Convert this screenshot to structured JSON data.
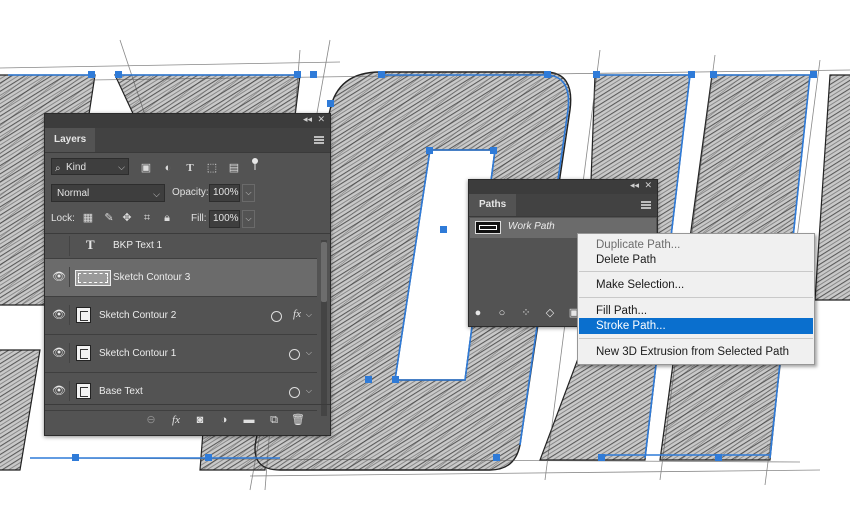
{
  "layers_panel": {
    "tab_label": "Layers",
    "filter": {
      "kind_label": "Kind"
    },
    "blend_mode": "Normal",
    "opacity_label": "Opacity:",
    "opacity_value": "100%",
    "lock_label": "Lock:",
    "fill_label": "Fill:",
    "fill_value": "100%",
    "layers": [
      {
        "name": "BKP Text 1",
        "type": "text",
        "visible": false
      },
      {
        "name": "Sketch Contour 3",
        "type": "path",
        "visible": true,
        "selected": true
      },
      {
        "name": "Sketch Contour 2",
        "type": "smart",
        "visible": true,
        "fx": true
      },
      {
        "name": "Sketch Contour 1",
        "type": "smart",
        "visible": true
      },
      {
        "name": "Base Text",
        "type": "smart",
        "visible": true
      }
    ]
  },
  "paths_panel": {
    "tab_label": "Paths",
    "paths": [
      {
        "name": "Work Path",
        "selected": true
      }
    ]
  },
  "context_menu": {
    "items": [
      {
        "label": "Duplicate Path...",
        "disabled": true
      },
      {
        "label": "Delete Path",
        "disabled": false
      },
      {
        "label": "Make Selection...",
        "disabled": false
      },
      {
        "label": "Fill Path...",
        "disabled": false
      },
      {
        "label": "Stroke Path...",
        "disabled": false,
        "highlighted": true
      },
      {
        "label": "New 3D Extrusion from Selected Path",
        "disabled": false
      }
    ]
  },
  "colors": {
    "panel_bg": "#535353",
    "selection_highlight": "#0a6fce",
    "path_anchor_blue": "#2f7bd8"
  },
  "icons": {
    "filter": [
      "image-filter-icon",
      "adjustment-filter-icon",
      "type-filter-icon",
      "shape-filter-icon",
      "smart-object-filter-icon"
    ],
    "lock": [
      "lock-transparent-pixels-icon",
      "lock-image-pixels-icon",
      "lock-position-icon",
      "lock-artboard-icon",
      "lock-all-icon"
    ],
    "layers_bottom": [
      "link-layers-icon",
      "add-layer-style-icon",
      "add-layer-mask-icon",
      "new-adjustment-layer-icon",
      "new-group-icon",
      "new-layer-icon",
      "delete-layer-icon"
    ],
    "paths_bottom": [
      "fill-path-icon",
      "stroke-path-icon",
      "load-as-selection-icon",
      "make-work-path-icon",
      "add-mask-icon"
    ]
  }
}
